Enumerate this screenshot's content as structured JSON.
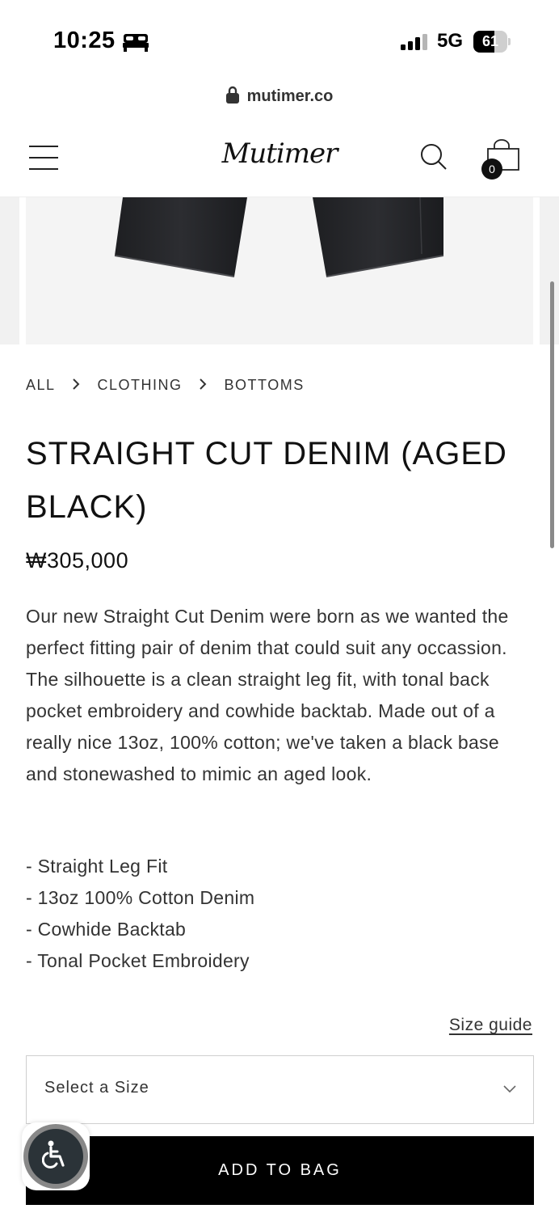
{
  "status_bar": {
    "time": "10:25",
    "network": "5G",
    "battery_level": 61,
    "battery_text": "61"
  },
  "browser": {
    "url": "mutimer.co"
  },
  "header": {
    "logo": "Mutimer",
    "bag_count": "0"
  },
  "breadcrumb": [
    "ALL",
    "CLOTHING",
    "BOTTOMS"
  ],
  "product": {
    "title": "STRAIGHT CUT DENIM (AGED BLACK)",
    "price": "₩305,000",
    "description": "Our new Straight Cut Denim were born as we wanted the perfect fitting pair of denim that could suit any occassion. The silhouette is a clean straight leg fit, with tonal back pocket embroidery and cowhide backtab. Made out of a really nice 13oz, 100% cotton; we've taken a black base and stonewashed to mimic an aged look.",
    "features": [
      "- Straight Leg Fit",
      "- 13oz 100% Cotton Denim",
      "- Cowhide Backtab",
      "- Tonal Pocket Embroidery"
    ],
    "size_guide_label": "Size guide",
    "size_select_placeholder": "Select a Size",
    "add_to_bag_label": "ADD TO BAG"
  },
  "colors": {
    "button_bg": "#000000",
    "page_bg": "#ffffff",
    "image_bg": "#f4f4f4"
  },
  "icons": [
    "bed-icon",
    "signal-icon",
    "lock-icon",
    "menu-icon",
    "search-icon",
    "bag-icon",
    "chevron-right-icon",
    "chevron-down-icon",
    "accessibility-icon"
  ]
}
